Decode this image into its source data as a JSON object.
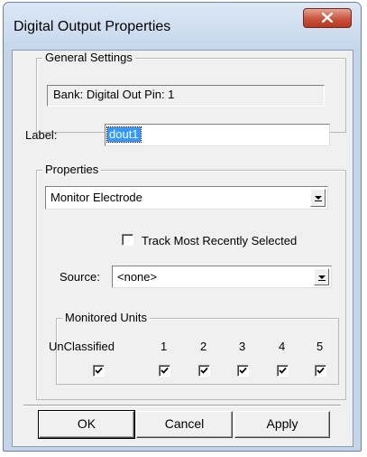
{
  "window": {
    "title": "Digital Output Properties"
  },
  "general": {
    "caption": "General Settings",
    "bank_info": "Bank: Digital Out   Pin: 1",
    "label_caption": "Label:",
    "label_value": "dout1"
  },
  "properties": {
    "caption": "Properties",
    "mode_value": "Monitor Electrode",
    "track_label": "Track Most Recently Selected",
    "track_checked": false,
    "source_caption": "Source:",
    "source_value": "<none>"
  },
  "units": {
    "caption": "Monitored Units",
    "columns": [
      "UnClassified",
      "1",
      "2",
      "3",
      "4",
      "5"
    ],
    "checked": [
      true,
      true,
      true,
      true,
      true,
      true
    ]
  },
  "buttons": {
    "ok": "OK",
    "cancel": "Cancel",
    "apply": "Apply"
  },
  "icons": {
    "close": "close-x-icon",
    "dropdown": "chevron-down-icon",
    "check": "checkmark-icon"
  },
  "colors": {
    "selection": "#3399ff",
    "close_button": "#c7533c",
    "dialog_bg": "#f0f0f0",
    "frame": "#c4d5ea"
  }
}
